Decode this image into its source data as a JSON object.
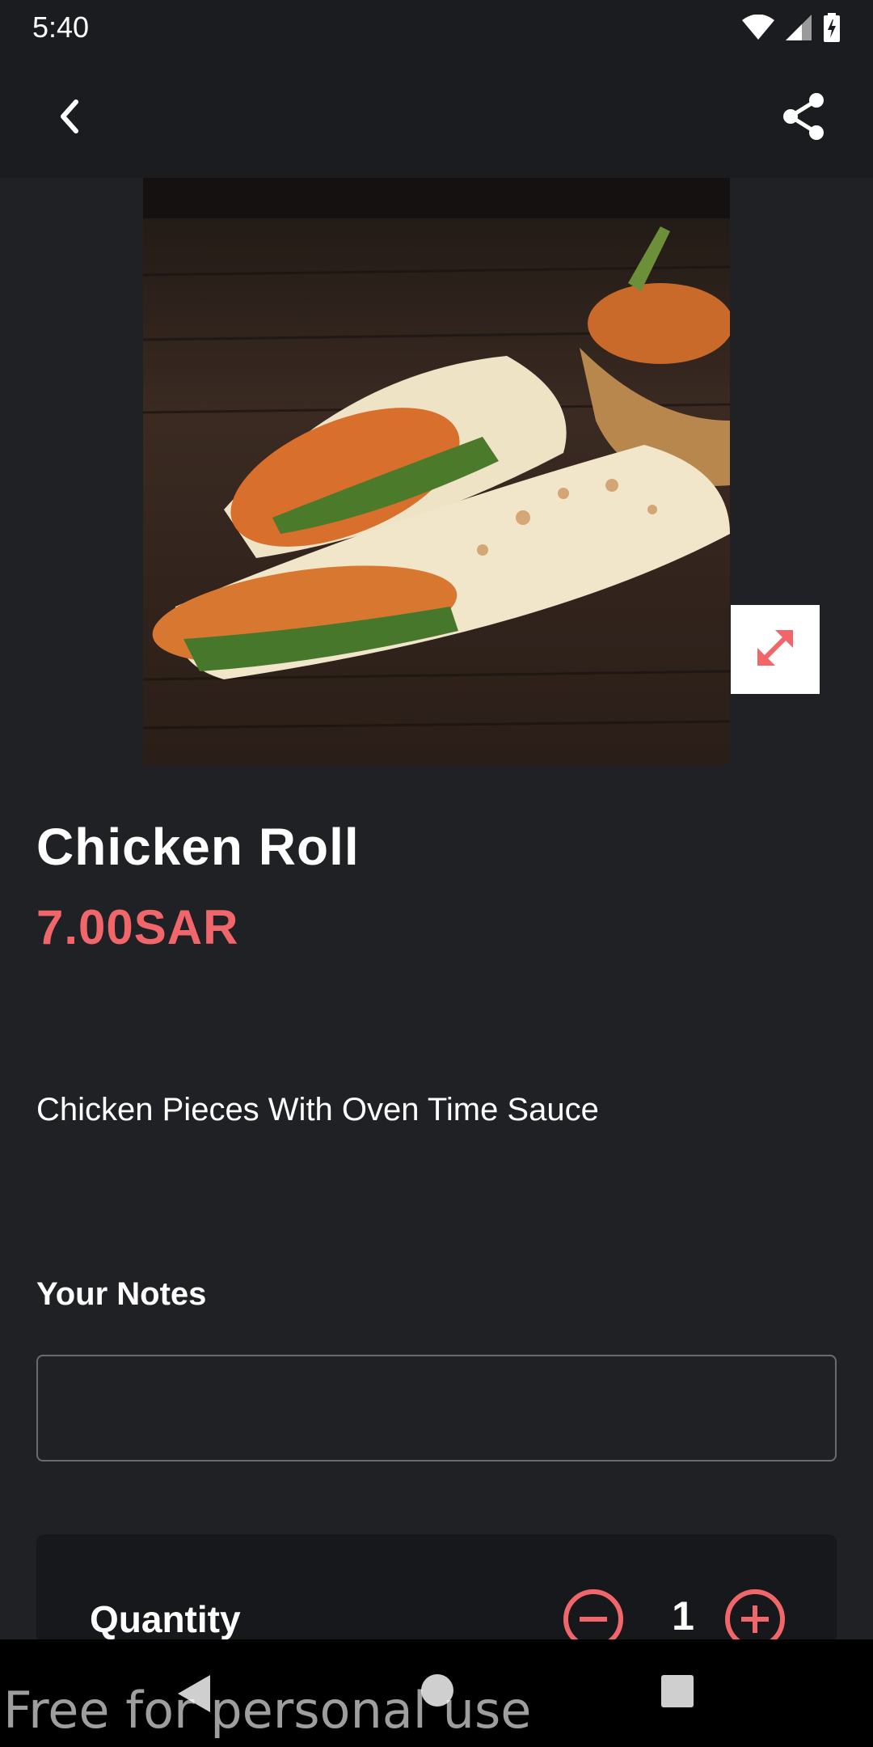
{
  "status_bar": {
    "time": "5:40",
    "icons": [
      "wifi-icon",
      "cellular-signal-icon",
      "battery-charging-icon"
    ]
  },
  "app_bar": {
    "back_icon": "chevron-left-icon",
    "share_icon": "share-icon"
  },
  "product": {
    "image_alt": "chicken-roll-photo",
    "name": "Chicken Roll",
    "price": "7.00SAR",
    "description": "Chicken Pieces With Oven Time Sauce",
    "expand_icon": "expand-arrows-icon"
  },
  "notes": {
    "label": "Your Notes",
    "value": "",
    "placeholder": ""
  },
  "quantity": {
    "label": "Quantity",
    "value": "1",
    "minus_icon": "minus-circle-icon",
    "plus_icon": "plus-circle-icon"
  },
  "nav_bar": {
    "back_icon": "nav-back-triangle-icon",
    "home_icon": "nav-home-circle-icon",
    "recents_icon": "nav-recents-square-icon"
  },
  "watermark": "Free for personal use",
  "colors": {
    "accent": "#f0666b",
    "background": "#202125",
    "app_bar": "#1b1c20"
  }
}
